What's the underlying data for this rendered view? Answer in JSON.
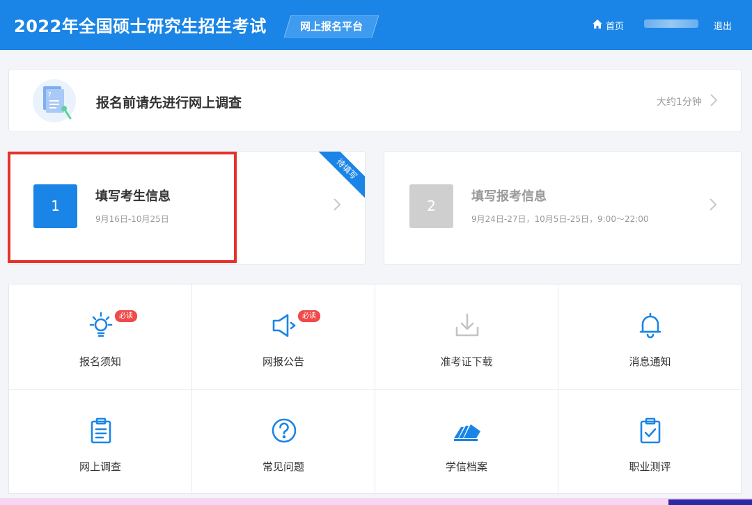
{
  "header": {
    "title": "2022年全国硕士研究生招生考试",
    "platform_tag": "网上报名平台",
    "home_label": "首页",
    "logout_label": "退出"
  },
  "survey": {
    "title": "报名前请先进行网上调查",
    "duration": "大约1分钟"
  },
  "steps": [
    {
      "number": "1",
      "title": "填写考生信息",
      "date": "9月16日-10月25日",
      "ribbon": "待填写"
    },
    {
      "number": "2",
      "title": "填写报考信息",
      "date": "9月24日-27日，10月5日-25日，9:00～22:00"
    }
  ],
  "tiles": [
    {
      "label": "报名须知",
      "badge": "必读",
      "icon": "lightbulb-icon"
    },
    {
      "label": "网报公告",
      "badge": "必读",
      "icon": "megaphone-icon"
    },
    {
      "label": "准考证下载",
      "icon": "download-icon"
    },
    {
      "label": "消息通知",
      "icon": "bell-icon"
    },
    {
      "label": "网上调查",
      "icon": "clipboard-icon"
    },
    {
      "label": "常见问题",
      "icon": "question-circle-icon"
    },
    {
      "label": "学信档案",
      "icon": "chsi-archive-icon"
    },
    {
      "label": "职业测评",
      "icon": "clipboard-check-icon"
    }
  ],
  "colors": {
    "brand_blue": "#1a85e6",
    "badge_red": "#f04a4a",
    "highlight_red": "#e5322d",
    "disabled_gray": "#cfcfcf"
  }
}
